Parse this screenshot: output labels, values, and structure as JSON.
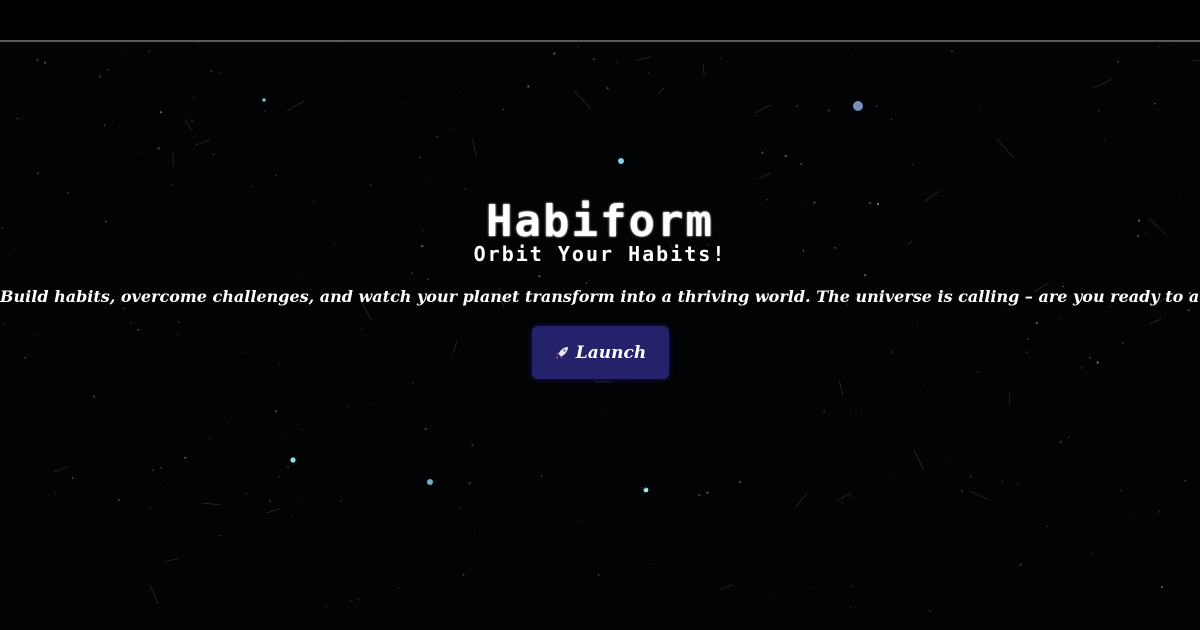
{
  "hero": {
    "title": "Habiform",
    "subtitle": "Orbit Your Habits!",
    "tagline": "Build habits, overcome challenges, and watch your planet transform into a thriving world. The universe is calling – are you ready to answer?"
  },
  "launch_button": {
    "label": "Launch",
    "icon": "rocket-icon"
  },
  "colors": {
    "background": "#020305",
    "button": "#23226a",
    "text": "#ffffff",
    "star": "#9fd6e6"
  }
}
